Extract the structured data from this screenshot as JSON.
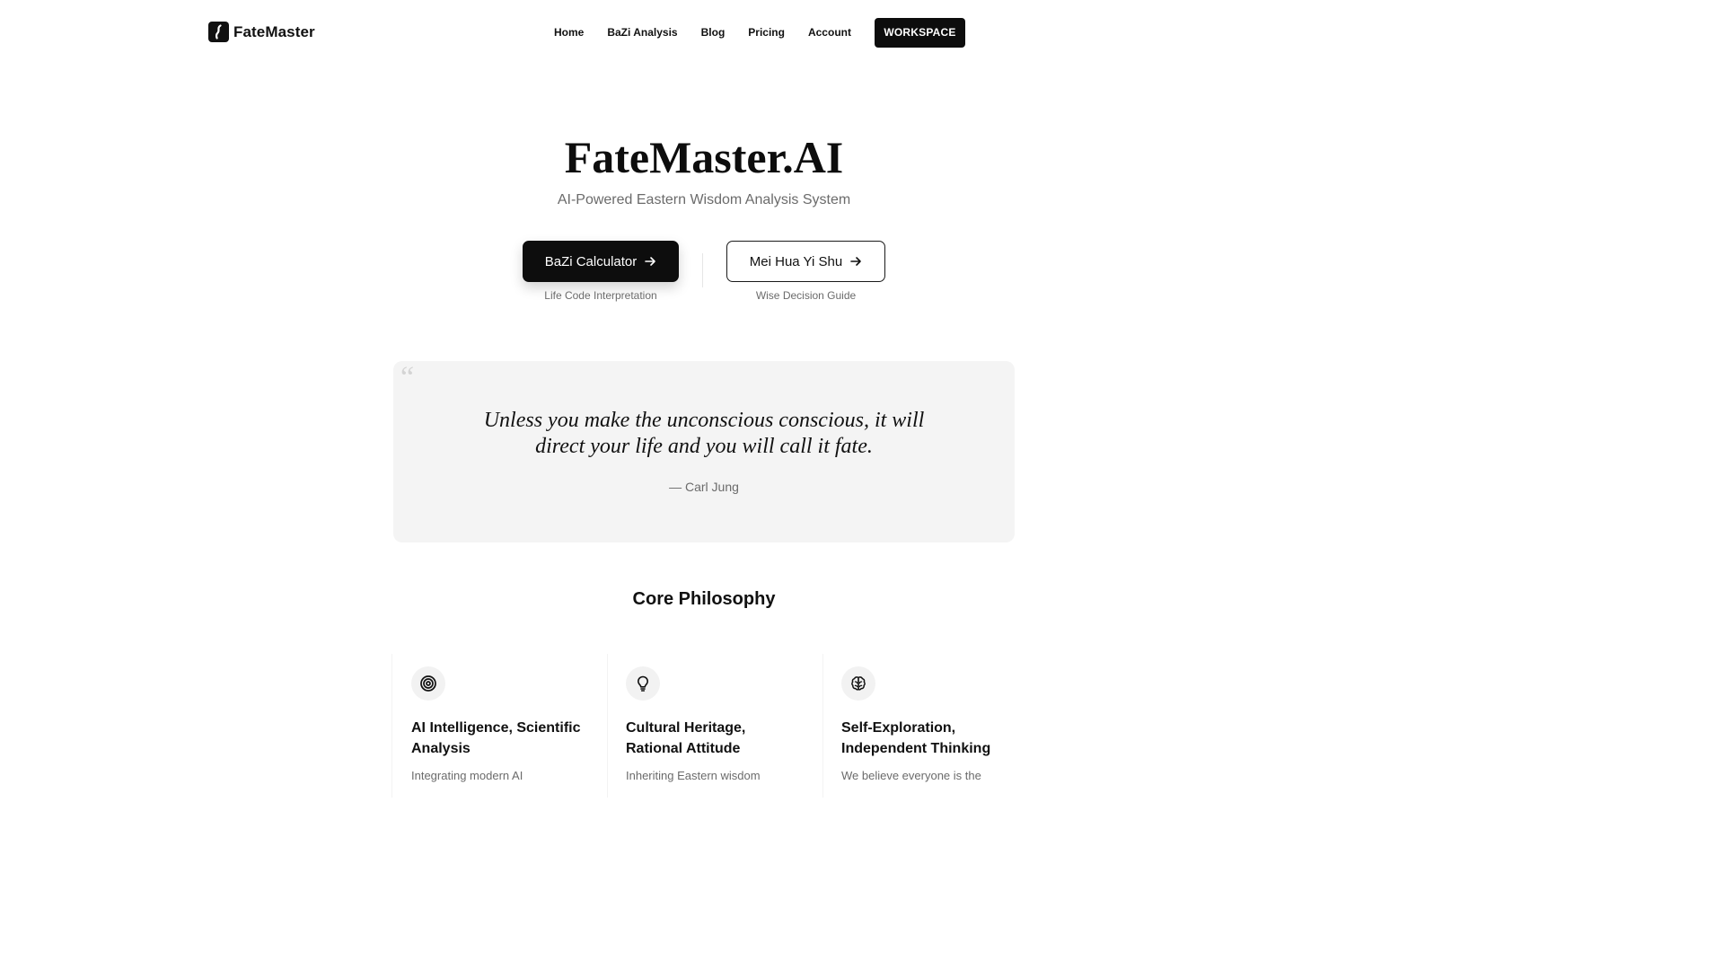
{
  "header": {
    "brand": "FateMaster",
    "nav": [
      {
        "label": "Home"
      },
      {
        "label": "BaZi Analysis"
      },
      {
        "label": "Blog"
      },
      {
        "label": "Pricing"
      },
      {
        "label": "Account"
      }
    ],
    "workspace_label": "WORKSPACE"
  },
  "hero": {
    "title": "FateMaster.AI",
    "subtitle": "AI-Powered Eastern Wisdom Analysis System",
    "primary_cta": {
      "label": "BaZi Calculator",
      "caption": "Life Code Interpretation"
    },
    "secondary_cta": {
      "label": "Mei Hua Yi Shu",
      "caption": "Wise Decision Guide"
    }
  },
  "quote": {
    "mark": "“",
    "text": "Unless you make the unconscious conscious, it will direct your life and you will call it fate.",
    "author": "— Carl Jung"
  },
  "philosophy": {
    "title": "Core Philosophy",
    "cards": [
      {
        "icon": "target-icon",
        "title": "AI Intelligence, Scientific Analysis",
        "desc": "Integrating modern AI"
      },
      {
        "icon": "lightbulb-icon",
        "title": "Cultural Heritage, Rational Attitude",
        "desc": "Inheriting Eastern wisdom"
      },
      {
        "icon": "brain-icon",
        "title": "Self-Exploration, Independent Thinking",
        "desc": "We believe everyone is the"
      }
    ]
  },
  "colors": {
    "primary": "#0d0d0d",
    "muted_text": "#6b6b6b",
    "quote_bg": "#f4f4f4",
    "icon_bg": "#f2f2f2"
  }
}
